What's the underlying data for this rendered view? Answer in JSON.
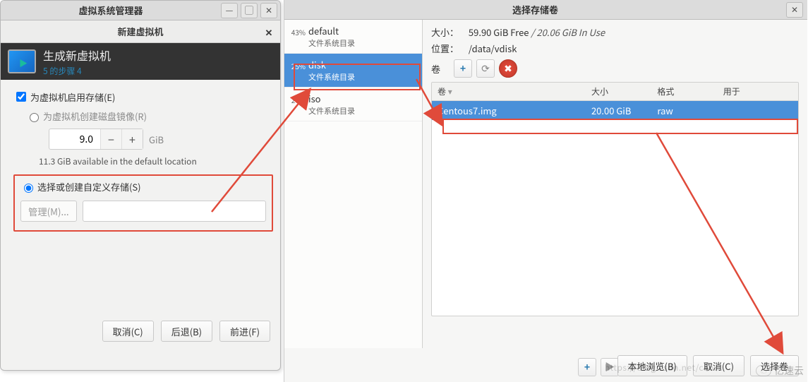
{
  "vm_window": {
    "title": "虚拟系统管理器",
    "dialog_title": "新建虚拟机",
    "banner_title": "生成新虚拟机",
    "banner_step": "5 的步骤 4",
    "enable_storage_label": "为虚拟机启用存储(E)",
    "create_disk_label": "为虚拟机创建磁盘镜像(R)",
    "disk_size_value": "9.0",
    "disk_size_unit": "GiB",
    "available_hint": "11.3 GiB available in the default location",
    "custom_storage_label": "选择或创建自定义存储(S)",
    "manage_btn": "管理(M)...",
    "btn_cancel": "取消(C)",
    "btn_back": "后退(B)",
    "btn_forward": "前进(F)"
  },
  "storage_window": {
    "title": "选择存储卷",
    "pools": [
      {
        "pct": "43%",
        "name": "default",
        "sub": "文件系统目录",
        "selected": false
      },
      {
        "pct": "25%",
        "name": "disk",
        "sub": "文件系统目录",
        "selected": true
      },
      {
        "pct": "27%",
        "name": "iso",
        "sub": "文件系统目录",
        "selected": false
      }
    ],
    "size_label": "大小：",
    "size_value_free": "59.90 GiB Free",
    "size_sep": " / ",
    "size_value_used": "20.06 GiB In Use",
    "location_label": "位置：",
    "location_value": "/data/vdisk",
    "vol_label": "卷",
    "table_headers": {
      "vol": "卷",
      "size": "大小",
      "format": "格式",
      "used_for": "用于"
    },
    "volumes": [
      {
        "name": "Centous7.img",
        "size": "20.00 GiB",
        "format": "raw",
        "used_for": ""
      }
    ],
    "btn_browse_local": "本地浏览(B)",
    "btn_cancel": "取消(C)",
    "btn_choose": "选择卷"
  },
  "watermark": {
    "blog": "https://blog.csdn.net/cao…",
    "brand": "亿速云"
  },
  "icons": {
    "minimize": "—",
    "maximize": "▢",
    "close": "✕",
    "plus": "+",
    "play": "▶",
    "del": "✖",
    "refresh": "⟳",
    "minus": "−"
  }
}
